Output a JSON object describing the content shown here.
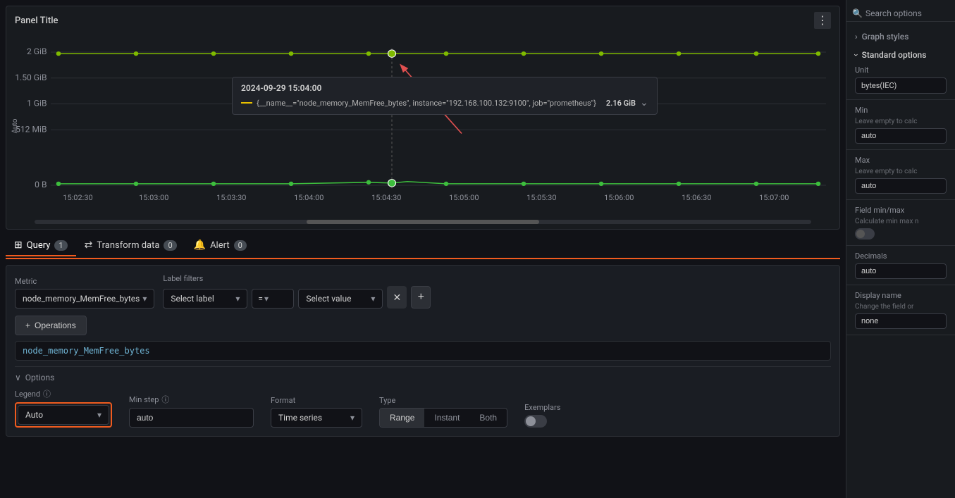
{
  "panel": {
    "title": "Panel Title"
  },
  "chart": {
    "tooltip_time": "2024-09-29 15:04:00",
    "tooltip_label": "{__name__=\"node_memory_MemFree_bytes\", instance=\"192.168.100.132:9100\", job=\"prometheus\"}",
    "tooltip_value": "2.16 GiB",
    "y_labels": [
      "2 GiB",
      "1.50 GiB",
      "1 GiB",
      "512 MiB",
      "0 B"
    ],
    "x_labels": [
      "15:02:30",
      "15:03:00",
      "15:03:30",
      "15:04:00",
      "15:04:30",
      "15:05:00",
      "15:05:30",
      "15:06:00",
      "15:06:30",
      "15:07:00"
    ],
    "axis_label": "Auto"
  },
  "tabs": {
    "query_label": "Query",
    "query_count": "1",
    "transform_label": "Transform data",
    "transform_count": "0",
    "alert_label": "Alert",
    "alert_count": "0"
  },
  "query": {
    "metric_label": "Metric",
    "metric_value": "node_memory_MemFree_bytes",
    "label_filters_label": "Label filters",
    "select_label_placeholder": "Select label",
    "select_value_placeholder": "Select value",
    "operator": "=",
    "expression": "node_memory_MemFree_bytes",
    "operations_label": "Operations"
  },
  "options": {
    "toggle_label": "Options",
    "legend_label": "Legend",
    "legend_info": "ⓘ",
    "legend_value": "Auto",
    "min_step_label": "Min step",
    "min_step_info": "ⓘ",
    "min_step_value": "auto",
    "format_label": "Format",
    "format_value": "Time series",
    "type_label": "Type",
    "type_range": "Range",
    "type_instant": "Instant",
    "type_both": "Both",
    "exemplars_label": "Exemplars"
  },
  "sidebar": {
    "search_placeholder": "Search options",
    "graph_styles_label": "Graph styles",
    "standard_options_label": "Standard options",
    "unit_label": "Unit",
    "unit_value": "bytes(IEC)",
    "min_label": "Min",
    "min_sub": "Leave empty to calc",
    "min_value": "auto",
    "max_label": "Max",
    "max_sub": "Leave empty to calc",
    "max_value": "auto",
    "field_minmax_label": "Field min/max",
    "field_minmax_sub": "Calculate min max n",
    "decimals_label": "Decimals",
    "decimals_value": "auto",
    "display_name_label": "Display name",
    "display_name_sub": "Change the field or",
    "display_name_value": "none"
  }
}
